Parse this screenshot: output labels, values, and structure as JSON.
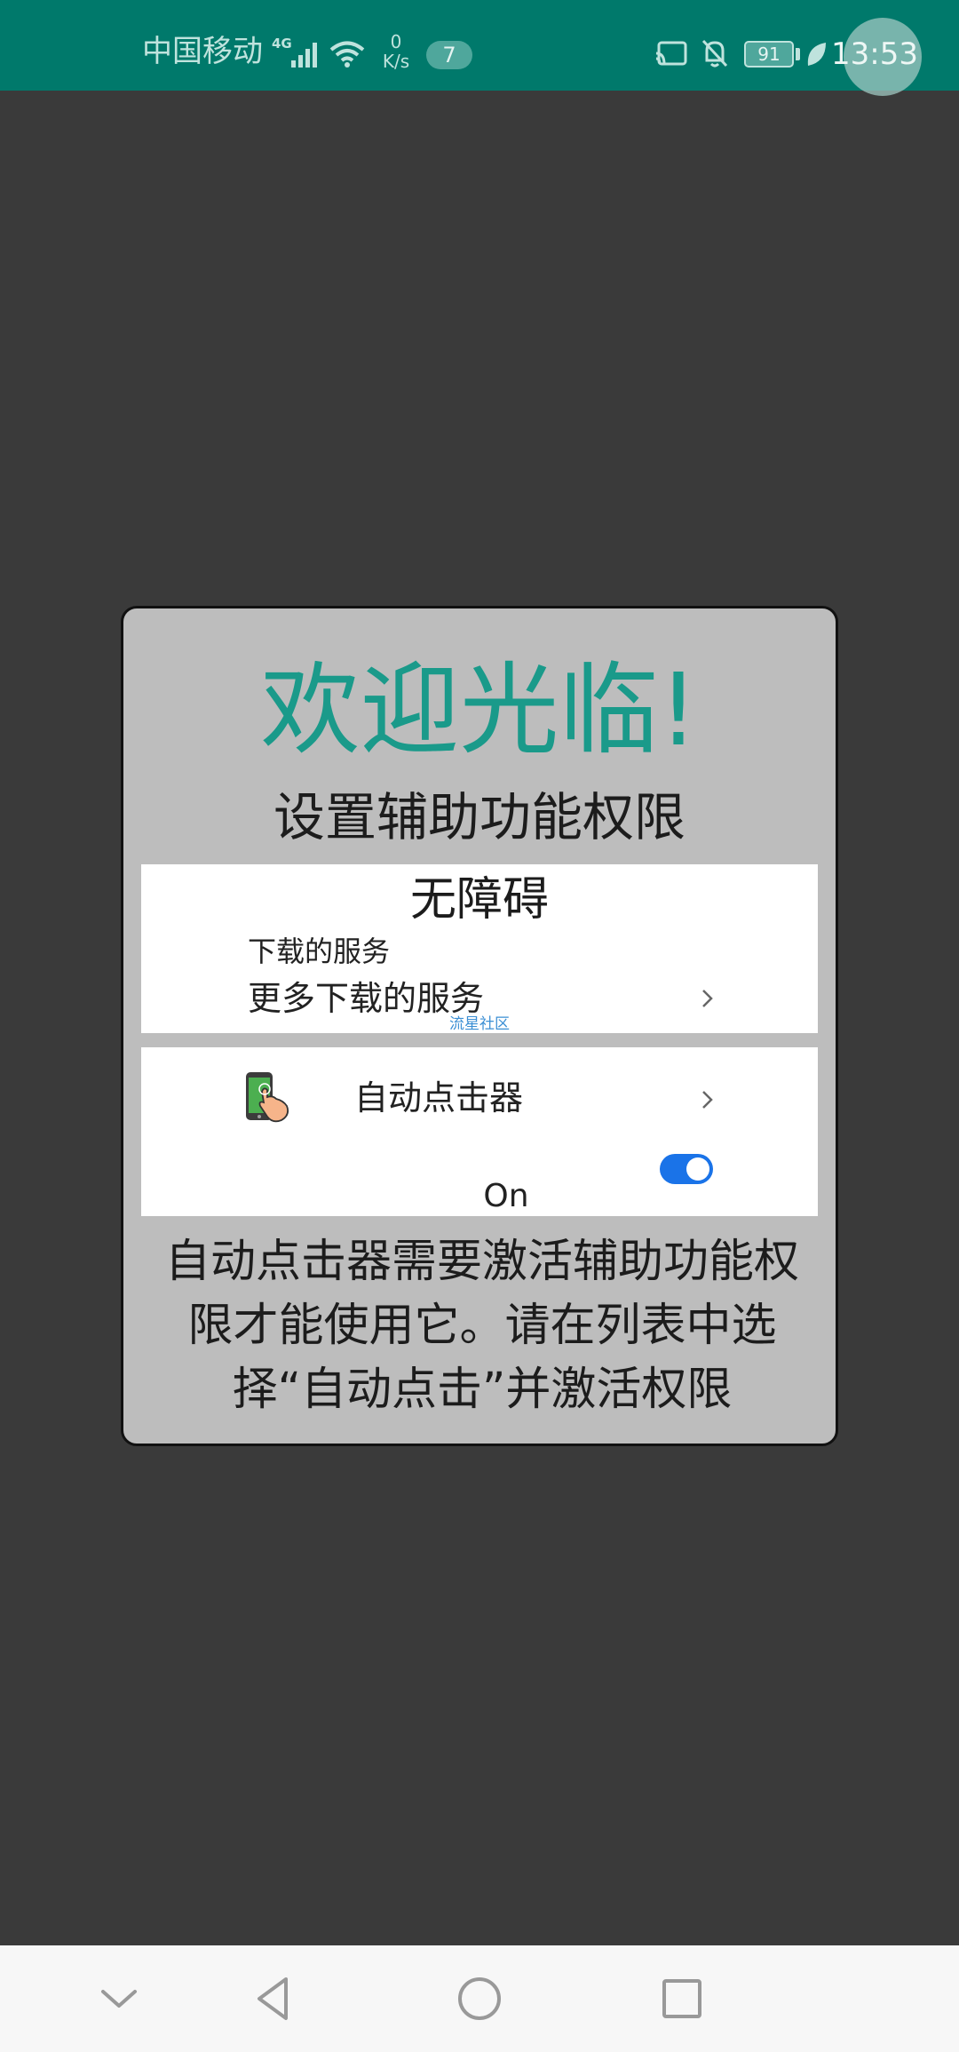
{
  "status_bar": {
    "carrier": "中国移动",
    "network_type": "4G",
    "net_speed_value": "0",
    "net_speed_unit": "K/s",
    "notification_count": "7",
    "battery": "91",
    "time": "13:53",
    "icons": [
      "signal-icon",
      "wifi-icon",
      "cast-icon",
      "bell-off-icon",
      "battery-icon",
      "leaf-icon"
    ]
  },
  "dialog": {
    "title": "欢迎光临!",
    "subtitle": "设置辅助功能权限",
    "accessibility_panel": {
      "title": "无障碍",
      "section_label": "下载的服务",
      "more_services": "更多下载的服务",
      "watermark": "流星社区"
    },
    "service_item": {
      "name": "自动点击器",
      "toggle_state": "On",
      "toggle_on": true
    },
    "instructions": "自动点击器需要激活辅助功能权限才能使用它。请在列表中选择“自动点击”并激活权限"
  },
  "nav_bar": {
    "buttons": [
      "hide-icon",
      "back-icon",
      "home-icon",
      "recent-apps-icon"
    ]
  },
  "colors": {
    "status_bar": "#00796b",
    "background": "#3a3a3a",
    "dialog": "#bdbdbd",
    "title": "#1a9a8a",
    "toggle": "#1a73e8"
  }
}
